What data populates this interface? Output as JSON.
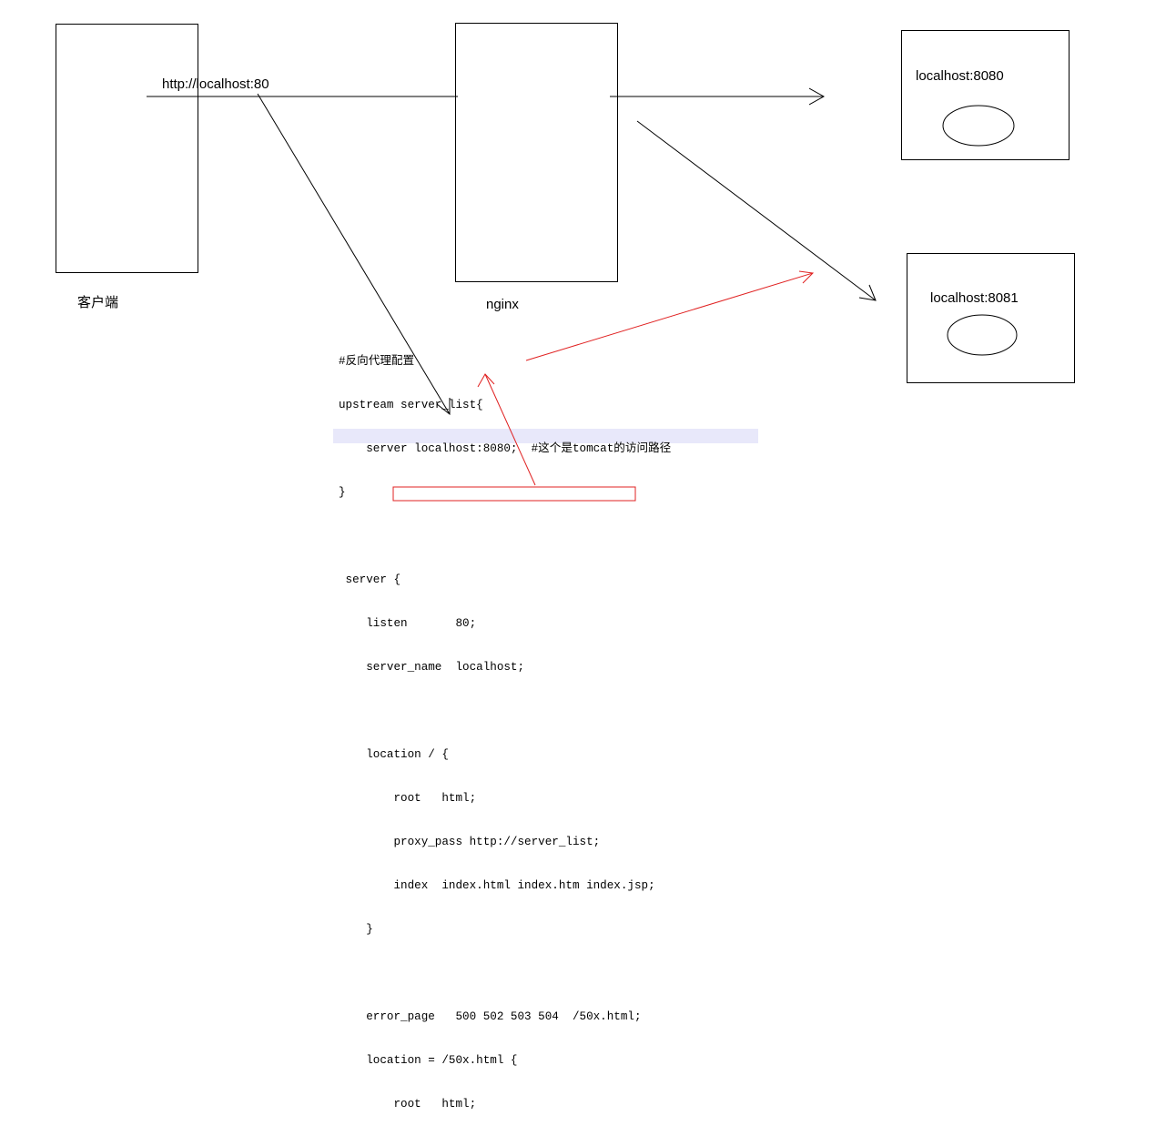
{
  "client": {
    "label": "客户端",
    "url": "http://localhost:80"
  },
  "nginx": {
    "label": "nginx"
  },
  "servers": [
    {
      "label": "localhost:8080"
    },
    {
      "label": "localhost:8081"
    }
  ],
  "code": {
    "lines": [
      "#反向代理配置",
      "upstream server_list{",
      "    server localhost:8080;  #这个是tomcat的访问路径",
      "}",
      "",
      " server {",
      "    listen       80;",
      "    server_name  localhost;",
      "",
      "    location / {",
      "        root   html;",
      "        proxy_pass http://server_list;",
      "        index  index.html index.htm index.jsp;",
      "    }",
      "",
      "    error_page   500 502 503 504  /50x.html;",
      "    location = /50x.html {",
      "        root   html;"
    ]
  },
  "colors": {
    "line": "#000000",
    "annotation": "#e02020",
    "highlight": "#e8e8fa"
  }
}
